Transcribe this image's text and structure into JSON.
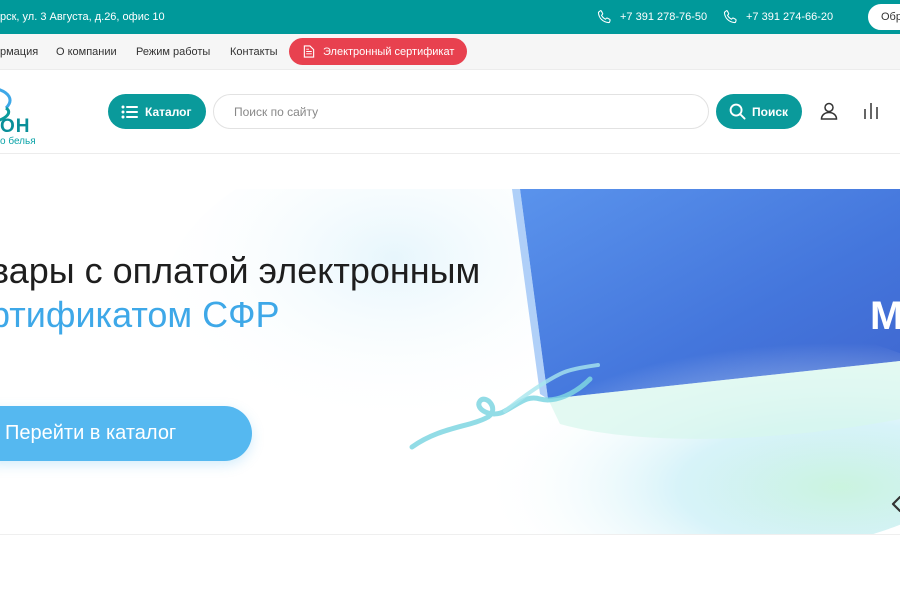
{
  "topbar": {
    "address": "рск, ул. 3 Августа, д.26, офис 10",
    "phone1": "+7 391 278-76-50",
    "phone2": "+7 391 274-66-20",
    "callback_label": "Обр"
  },
  "nav": {
    "items": [
      {
        "label": "рмация"
      },
      {
        "label": "О компании"
      },
      {
        "label": "Режим работы"
      },
      {
        "label": "Контакты"
      }
    ],
    "cert_button": "Электронный сертификат"
  },
  "header": {
    "logo_name": "ОН",
    "logo_sub": "о белья",
    "catalog_label": "Каталог",
    "search_placeholder": "Поиск по сайту",
    "search_button": "Поиск"
  },
  "banner": {
    "title_line1": "вары с оплатой электронным",
    "title_line2": "ртификатом СФР",
    "button_label": "Перейти в каталог",
    "card_letter": "М"
  },
  "colors": {
    "brand_teal": "#00999a",
    "cert_red": "#e8414f",
    "accent_blue": "#3ea8e8",
    "card_blue": "#4b7fe0"
  }
}
